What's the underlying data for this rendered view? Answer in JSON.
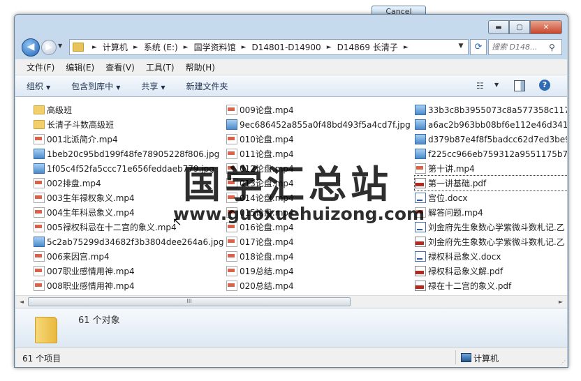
{
  "dialog_behind": {
    "cancel_label": "Cancel"
  },
  "window": {
    "minimize": "▬",
    "maximize": "▢",
    "close": "✕"
  },
  "address": {
    "parts": [
      "计算机",
      "系统 (E:)",
      "国学资料馆",
      "D14801-D14900",
      "D14869 长清子"
    ],
    "separator": "►",
    "search_placeholder": "搜索 D148..."
  },
  "menu": [
    "文件(F)",
    "编辑(E)",
    "查看(V)",
    "工具(T)",
    "帮助(H)"
  ],
  "toolbar": {
    "organize": "组织",
    "include_library": "包含到库中",
    "share": "共享",
    "new_folder": "新建文件夹"
  },
  "files": {
    "col1": [
      {
        "name": "高级班",
        "type": "folder"
      },
      {
        "name": "长清子斗数高级班",
        "type": "folder"
      },
      {
        "name": "001北派简介.mp4",
        "type": "mp4"
      },
      {
        "name": "1beb20c95bd199f48fe78905228f806.jpg",
        "type": "jpg"
      },
      {
        "name": "1f05c4f52fa5ccc71e656feddaeb779.jpg",
        "type": "jpg"
      },
      {
        "name": "002排盘.mp4",
        "type": "mp4"
      },
      {
        "name": "003生年禄权象义.mp4",
        "type": "mp4"
      },
      {
        "name": "004生年科忌象义.mp4",
        "type": "mp4"
      },
      {
        "name": "005禄权科忌在十二宫的象义.mp4",
        "type": "mp4"
      },
      {
        "name": "5c2ab75299d34682f3b3804dee264a6.jpg",
        "type": "jpg"
      },
      {
        "name": "006来因宫.mp4",
        "type": "mp4"
      },
      {
        "name": "007职业感情用神.mp4",
        "type": "mp4"
      },
      {
        "name": "008职业感情用神.mp4",
        "type": "mp4"
      }
    ],
    "col2": [
      {
        "name": "009论盘.mp4",
        "type": "mp4"
      },
      {
        "name": "9ec686452a855a0f48bd493f5a4cd7f.jpg",
        "type": "jpg"
      },
      {
        "name": "010论盘.mp4",
        "type": "mp4"
      },
      {
        "name": "011论盘.mp4",
        "type": "mp4"
      },
      {
        "name": "012论盘.mp4",
        "type": "mp4"
      },
      {
        "name": "013论盘.mp4",
        "type": "mp4"
      },
      {
        "name": "014论盘.mp4",
        "type": "mp4"
      },
      {
        "name": "015论盘.mp4",
        "type": "mp4"
      },
      {
        "name": "016论盘.mp4",
        "type": "mp4"
      },
      {
        "name": "017论盘.mp4",
        "type": "mp4"
      },
      {
        "name": "018论盘.mp4",
        "type": "mp4"
      },
      {
        "name": "019总结.mp4",
        "type": "mp4"
      },
      {
        "name": "020总结.mp4",
        "type": "mp4"
      }
    ],
    "col3": [
      {
        "name": "33b3c8b3955073c8a577358c1175",
        "type": "jpg"
      },
      {
        "name": "a6ac2b963bb08bf6e112e46d3413",
        "type": "jpg"
      },
      {
        "name": "d379b87e4f8f5badcc62d7ed3be9",
        "type": "jpg"
      },
      {
        "name": "f225cc966eb759312a9551175b7d",
        "type": "jpg"
      },
      {
        "name": "第十讲.mp4",
        "type": "mp4"
      },
      {
        "name": "第一讲基础.pdf",
        "type": "pdf",
        "selected": true
      },
      {
        "name": "宫位.docx",
        "type": "docx"
      },
      {
        "name": "解答问题.mp4",
        "type": "mp4"
      },
      {
        "name": "刘金府先生象数心学紫微斗数札记.乙",
        "type": "docx"
      },
      {
        "name": "刘金府先生象数心学紫微斗数札记.乙",
        "type": "pdf"
      },
      {
        "name": "禄权科忌象义.docx",
        "type": "docx"
      },
      {
        "name": "禄权科忌象义解.pdf",
        "type": "pdf"
      },
      {
        "name": "禄在十二宫的象义.pdf",
        "type": "pdf"
      }
    ]
  },
  "scrollbar": {
    "left": "◄",
    "right": "►",
    "thumb": "III"
  },
  "details_pane": {
    "count_text": "61 个对象"
  },
  "status": {
    "items": "61 个项目",
    "location": "计算机"
  },
  "watermark": {
    "cn": "国学汇总站",
    "url": "www.guoxuehuizong.com"
  }
}
